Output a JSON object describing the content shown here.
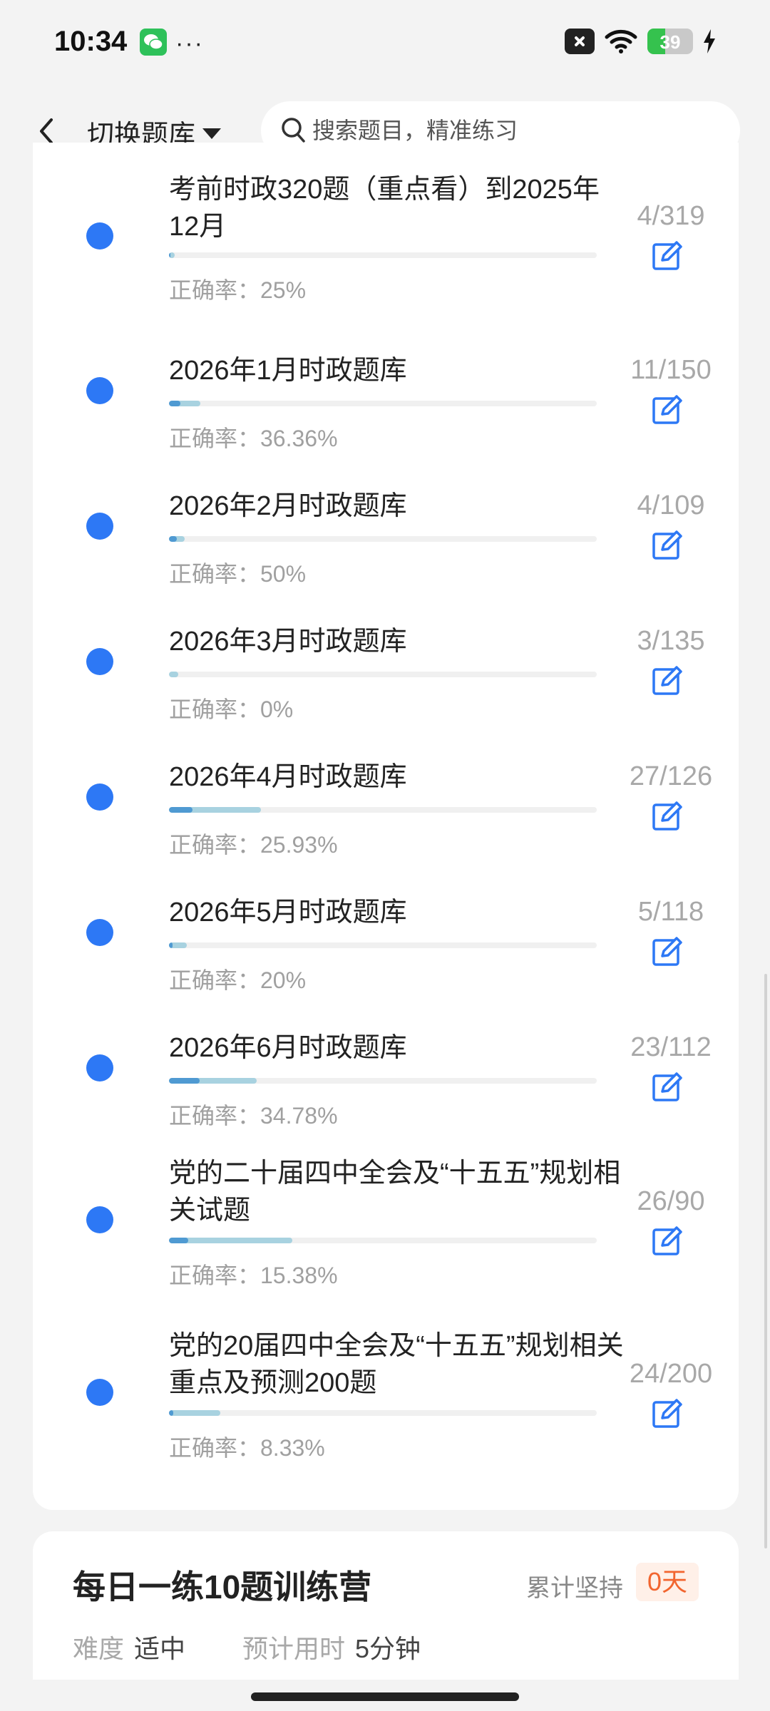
{
  "status_bar": {
    "time": "10:34",
    "more": "···",
    "battery": "39",
    "battery_level": 0.39,
    "icons": [
      "wechat-icon",
      "close-notification-icon",
      "wifi-icon",
      "battery-icon",
      "charging-icon"
    ]
  },
  "header": {
    "switch_label": "切换题库",
    "search_placeholder": "搜索题目，精准练习"
  },
  "items": [
    {
      "title": "考前时政320题（重点看）到2025年12月",
      "done": 4,
      "total": 319,
      "count": "4/319",
      "accuracy_label": "正确率：25%",
      "accuracy": 0.25
    },
    {
      "title": "2026年1月时政题库",
      "done": 11,
      "total": 150,
      "count": "11/150",
      "accuracy_label": "正确率：36.36%",
      "accuracy": 0.3636
    },
    {
      "title": "2026年2月时政题库",
      "done": 4,
      "total": 109,
      "count": "4/109",
      "accuracy_label": "正确率：50%",
      "accuracy": 0.5
    },
    {
      "title": "2026年3月时政题库",
      "done": 3,
      "total": 135,
      "count": "3/135",
      "accuracy_label": "正确率：0%",
      "accuracy": 0
    },
    {
      "title": "2026年4月时政题库",
      "done": 27,
      "total": 126,
      "count": "27/126",
      "accuracy_label": "正确率：25.93%",
      "accuracy": 0.2593
    },
    {
      "title": "2026年5月时政题库",
      "done": 5,
      "total": 118,
      "count": "5/118",
      "accuracy_label": "正确率：20%",
      "accuracy": 0.2
    },
    {
      "title": "2026年6月时政题库",
      "done": 23,
      "total": 112,
      "count": "23/112",
      "accuracy_label": "正确率：34.78%",
      "accuracy": 0.3478
    },
    {
      "title": "党的二十届四中全会及“十五五”规划相关试题",
      "done": 26,
      "total": 90,
      "count": "26/90",
      "accuracy_label": "正确率：15.38%",
      "accuracy": 0.1538
    },
    {
      "title": "党的20届四中全会及“十五五”规划相关重点及预测200题",
      "done": 24,
      "total": 200,
      "count": "24/200",
      "accuracy_label": "正确率：8.33%",
      "accuracy": 0.0833
    }
  ],
  "camp": {
    "title": "每日一练10题训练营",
    "streak_label": "累计坚持",
    "streak_value": "0天",
    "difficulty_label": "难度",
    "difficulty_value": "适中",
    "time_label": "预计用时",
    "time_value": "5分钟"
  },
  "colors": {
    "accent": "#2d78f5",
    "progress_light": "#a8d2e0",
    "progress_dark": "#4f9ad2",
    "streak": "#f2652f"
  }
}
